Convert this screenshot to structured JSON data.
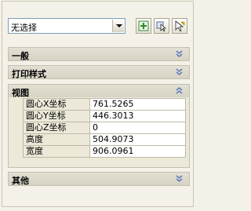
{
  "toolbar": {
    "select_value": "无选择",
    "buttons": [
      {
        "icon": "quick-select-icon"
      },
      {
        "icon": "select-objects-icon"
      },
      {
        "icon": "toggle-pickadd-icon"
      }
    ]
  },
  "sections": {
    "general": "一般",
    "plot_style": "打印样式",
    "view": "视图",
    "misc": "其他"
  },
  "view_properties": [
    {
      "label": "圆心X坐标",
      "value": "761.5265"
    },
    {
      "label": "圆心Y坐标",
      "value": "446.3013"
    },
    {
      "label": "圆心Z坐标",
      "value": "0"
    },
    {
      "label": "高度",
      "value": "504.9073"
    },
    {
      "label": "宽度",
      "value": "906.0961"
    }
  ],
  "colors": {
    "panel_bg": "#f4f2e8",
    "section_bg": "#dcd8ca",
    "chevron": "#5a7fc0"
  }
}
